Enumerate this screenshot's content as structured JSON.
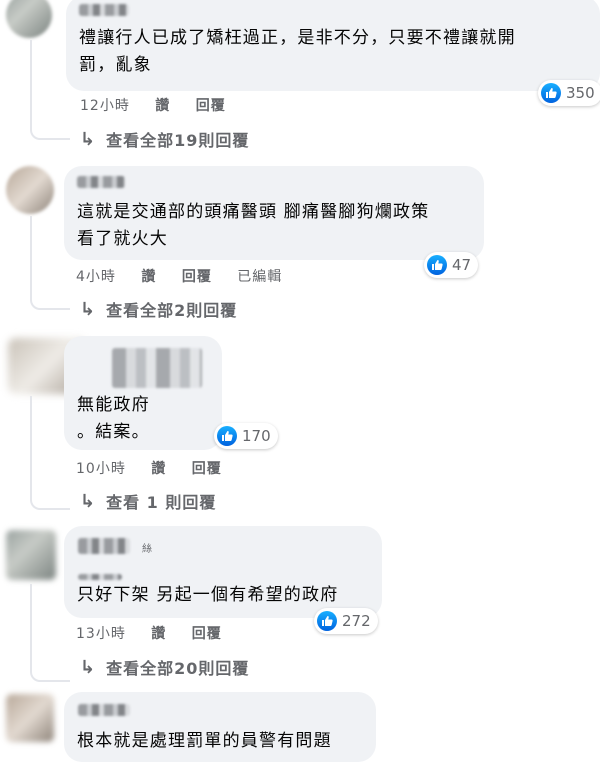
{
  "comments": [
    {
      "text": "禮讓行人已成了矯枉過正，是非不分，只要不禮讓就開\n罰，亂象",
      "time": "12小時",
      "like_label": "讚",
      "reply_label": "回覆",
      "likes": "350",
      "replies_link": "查看全部19則回覆"
    },
    {
      "text": "這就是交通部的頭痛醫頭 腳痛醫腳狗爛政策\n看了就火大",
      "time": "4小時",
      "like_label": "讚",
      "reply_label": "回覆",
      "edited": "已編輯",
      "likes": "47",
      "replies_link": "查看全部2則回覆"
    },
    {
      "text": "無能政府\n。結案。",
      "time": "10小時",
      "like_label": "讚",
      "reply_label": "回覆",
      "likes": "170",
      "replies_link": "查看 1 則回覆"
    },
    {
      "text": "只好下架 另起一個有希望的政府",
      "time": "13小時",
      "like_label": "讚",
      "reply_label": "回覆",
      "likes": "272",
      "replies_link": "查看全部20則回覆",
      "name_suffix": "絲"
    },
    {
      "text": "根本就是處理罰單的員警有問題"
    }
  ],
  "colors": {
    "bubble": "#f0f2f5",
    "meta": "#65676b",
    "like_blue": "#0571ed"
  }
}
